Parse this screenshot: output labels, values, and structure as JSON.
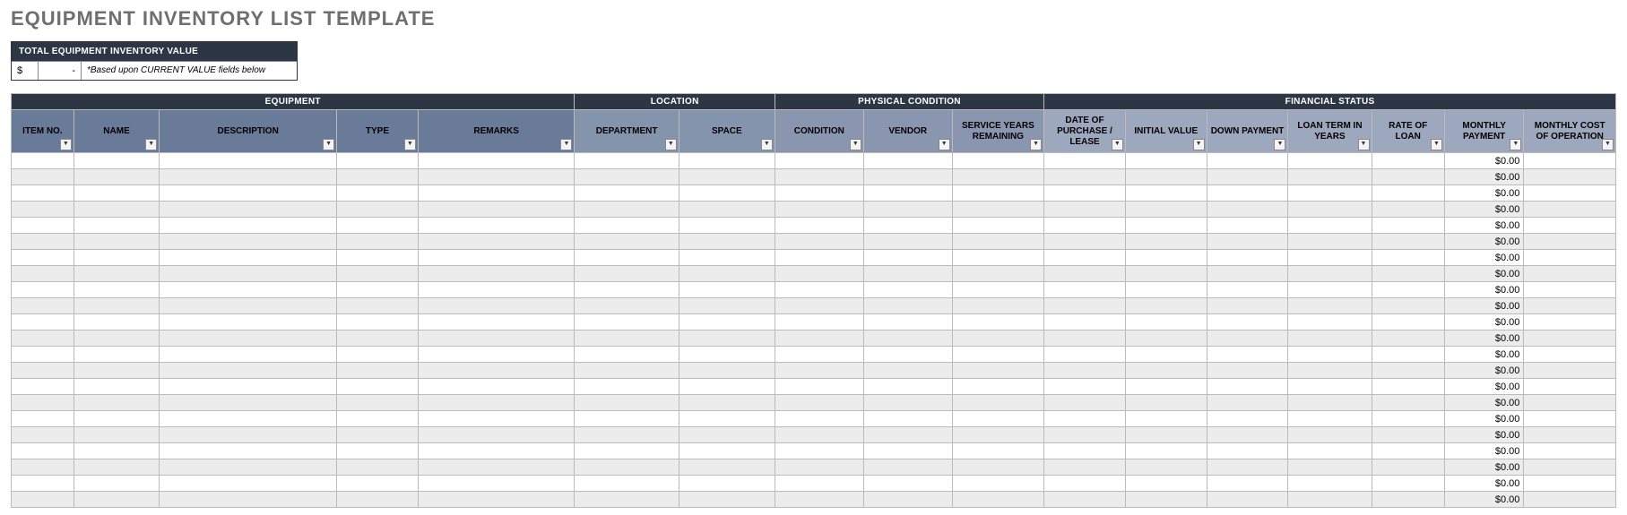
{
  "title": "EQUIPMENT INVENTORY LIST TEMPLATE",
  "summary": {
    "header": "TOTAL EQUIPMENT INVENTORY VALUE",
    "currency": "$",
    "value": "-",
    "note": "*Based upon CURRENT VALUE fields below"
  },
  "groups": {
    "equipment": "EQUIPMENT",
    "location": "LOCATION",
    "condition": "PHYSICAL CONDITION",
    "financial": "FINANCIAL STATUS"
  },
  "columns": {
    "item_no": "ITEM NO.",
    "name": "NAME",
    "description": "DESCRIPTION",
    "type": "TYPE",
    "remarks": "REMARKS",
    "department": "DEPARTMENT",
    "space": "SPACE",
    "condition": "CONDITION",
    "vendor": "VENDOR",
    "service_years": "SERVICE YEARS REMAINING",
    "date_purchase": "DATE OF PURCHASE / LEASE",
    "initial_value": "INITIAL VALUE",
    "down_payment": "DOWN PAYMENT",
    "loan_term": "LOAN TERM IN YEARS",
    "rate": "RATE OF LOAN",
    "monthly_payment": "MONTHLY PAYMENT",
    "monthly_cost": "MONTHLY COST OF OPERATION"
  },
  "rows": [
    {
      "monthly_payment": "$0.00"
    },
    {
      "monthly_payment": "$0.00"
    },
    {
      "monthly_payment": "$0.00"
    },
    {
      "monthly_payment": "$0.00"
    },
    {
      "monthly_payment": "$0.00"
    },
    {
      "monthly_payment": "$0.00"
    },
    {
      "monthly_payment": "$0.00"
    },
    {
      "monthly_payment": "$0.00"
    },
    {
      "monthly_payment": "$0.00"
    },
    {
      "monthly_payment": "$0.00"
    },
    {
      "monthly_payment": "$0.00"
    },
    {
      "monthly_payment": "$0.00"
    },
    {
      "monthly_payment": "$0.00"
    },
    {
      "monthly_payment": "$0.00"
    },
    {
      "monthly_payment": "$0.00"
    },
    {
      "monthly_payment": "$0.00"
    },
    {
      "monthly_payment": "$0.00"
    },
    {
      "monthly_payment": "$0.00"
    },
    {
      "monthly_payment": "$0.00"
    },
    {
      "monthly_payment": "$0.00"
    },
    {
      "monthly_payment": "$0.00"
    },
    {
      "monthly_payment": "$0.00"
    }
  ]
}
